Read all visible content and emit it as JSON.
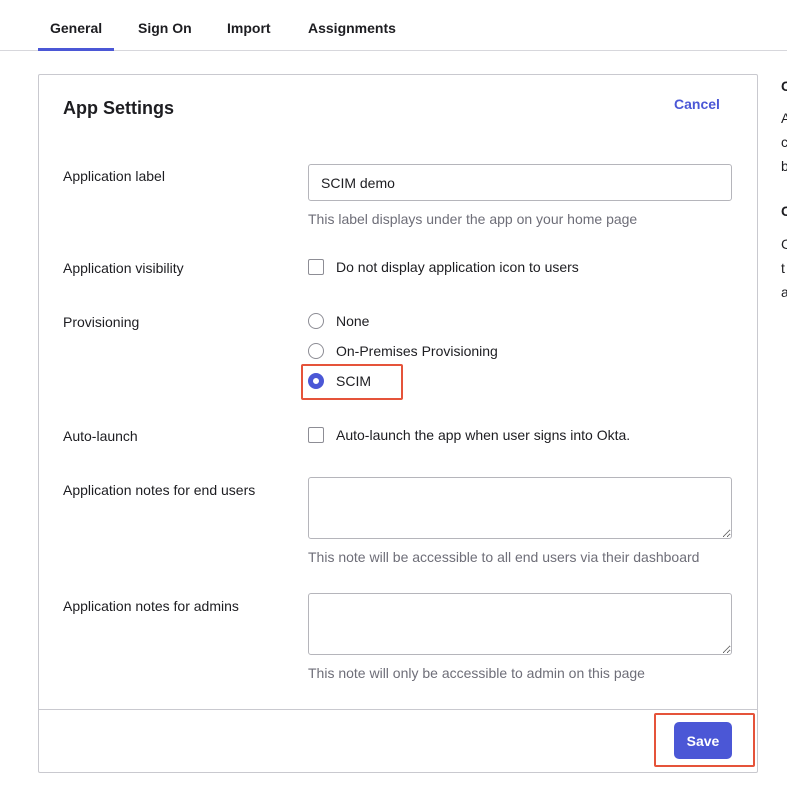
{
  "tabs": [
    {
      "label": "General"
    },
    {
      "label": "Sign On"
    },
    {
      "label": "Import"
    },
    {
      "label": "Assignments"
    }
  ],
  "panel": {
    "title": "App Settings",
    "cancel_label": "Cancel"
  },
  "fields": {
    "app_label": {
      "label": "Application label",
      "value": "SCIM demo",
      "hint": "This label displays under the app on your home page"
    },
    "visibility": {
      "label": "Application visibility",
      "option": "Do not display application icon to users",
      "checked": false
    },
    "provisioning": {
      "label": "Provisioning",
      "options": [
        "None",
        "On-Premises Provisioning",
        "SCIM"
      ],
      "selected": "SCIM"
    },
    "auto_launch": {
      "label": "Auto-launch",
      "option": "Auto-launch the app when user signs into Okta.",
      "checked": false
    },
    "notes_end_users": {
      "label": "Application notes for end users",
      "value": "",
      "hint": "This note will be accessible to all end users via their dashboard"
    },
    "notes_admins": {
      "label": "Application notes for admins",
      "value": "",
      "hint": "This note will only be accessible to admin on this page"
    }
  },
  "footer": {
    "save_label": "Save"
  },
  "side_panel_fragments": [
    "C",
    "A",
    "c",
    "b",
    "C",
    "C",
    "t",
    "a"
  ],
  "colors": {
    "accent": "#4b57d6",
    "highlight": "#e5533a",
    "border": "#c9c9cf",
    "hint_text": "#6e6e78"
  }
}
